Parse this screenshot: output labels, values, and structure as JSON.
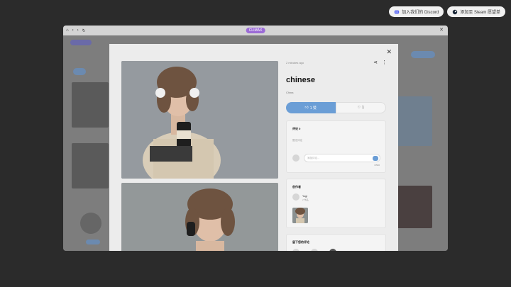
{
  "top_buttons": {
    "discord": "加入我们的 Discord",
    "steam": "添加至 Steam 愿望单"
  },
  "window": {
    "brand": "CLIMAX"
  },
  "post": {
    "timestamp": "2 minutes ago",
    "title": "chinese",
    "subtitle": "China",
    "like_label": "1 赞",
    "fav_label": "1"
  },
  "comments": {
    "title": "评论 0",
    "empty": "暂无评论",
    "placeholder": "添加评论...",
    "count": "0/500"
  },
  "creator": {
    "title": "创作者",
    "name": "Yogi",
    "sub": "2 作品"
  },
  "more": {
    "title": "留下您的评论"
  },
  "colors": {
    "accent": "#6b9ed6",
    "brand": "#9b6bd6"
  }
}
